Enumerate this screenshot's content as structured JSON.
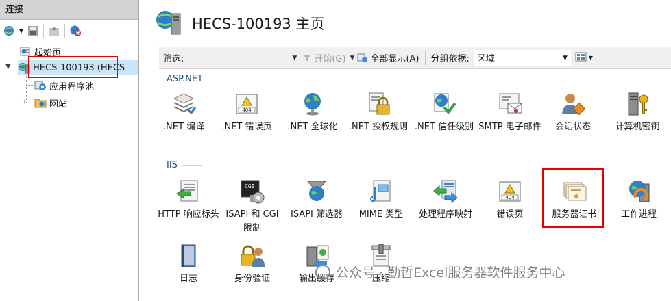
{
  "connections": {
    "header": "连接",
    "tree": {
      "start_page": "起始页",
      "server": "HECS-100193 (HECS",
      "app_pools": "应用程序池",
      "sites": "网站"
    }
  },
  "main": {
    "title": "HECS-100193 主页",
    "filter_bar": {
      "filter_label": "筛选:",
      "filter_value": "",
      "start_label": "开始(G)",
      "show_all_label": "全部显示(A)",
      "group_by_label": "分组依据:",
      "group_by_value": "区域"
    },
    "sections": [
      {
        "title": "ASP.NET",
        "items": [
          {
            "label": ".NET 编译",
            "icon": "net-compile-icon"
          },
          {
            "label": ".NET 错误页",
            "icon": "error-page-404-icon"
          },
          {
            "label": ".NET 全球化",
            "icon": "globe-icon"
          },
          {
            "label": ".NET 授权规则",
            "icon": "lock-document-icon"
          },
          {
            "label": ".NET 信任级别",
            "icon": "trust-level-icon"
          },
          {
            "label": "SMTP 电子邮件",
            "icon": "smtp-email-icon"
          },
          {
            "label": "会话状态",
            "icon": "session-state-icon"
          },
          {
            "label": "计算机密钥",
            "icon": "machine-key-icon"
          }
        ]
      },
      {
        "title": "IIS",
        "items": [
          {
            "label": "HTTP 响应标头",
            "icon": "http-headers-icon"
          },
          {
            "label": "ISAPI 和 CGI 限制",
            "icon": "isapi-cgi-icon"
          },
          {
            "label": "ISAPI 筛选器",
            "icon": "isapi-filter-icon"
          },
          {
            "label": "MIME 类型",
            "icon": "mime-types-icon"
          },
          {
            "label": "处理程序映射",
            "icon": "handler-mappings-icon"
          },
          {
            "label": "错误页",
            "icon": "error-page-404-icon"
          },
          {
            "label": "服务器证书",
            "icon": "server-certificate-icon"
          },
          {
            "label": "工作进程",
            "icon": "worker-process-icon"
          },
          {
            "label": "日志",
            "icon": "logging-icon"
          },
          {
            "label": "身份验证",
            "icon": "authentication-icon"
          },
          {
            "label": "输出缓存",
            "icon": "output-cache-icon"
          },
          {
            "label": "压缩",
            "icon": "compression-icon"
          }
        ]
      }
    ]
  },
  "watermark": "公众号 · 勤哲Excel服务器软件服务中心",
  "colors": {
    "selection": "#cce4f7",
    "highlight_box": "#e00000",
    "section_title": "#1f4e8c"
  }
}
